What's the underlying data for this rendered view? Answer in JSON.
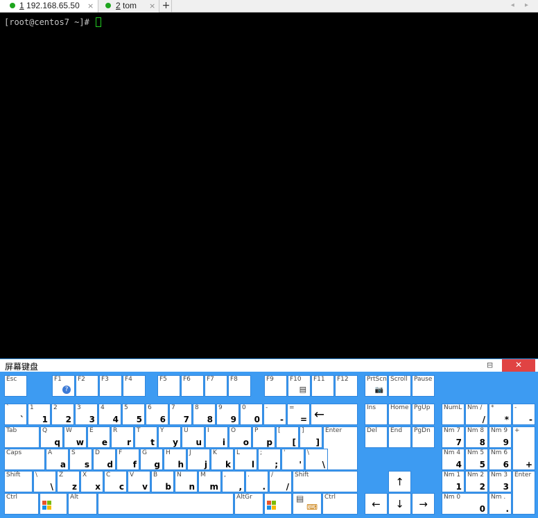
{
  "tabs": [
    {
      "num": "1",
      "label": "192.168.65.50",
      "close": "×"
    },
    {
      "num": "2",
      "label": "tom",
      "close": "×"
    }
  ],
  "new_tab": "+",
  "tab_nav": "◂ ▸",
  "terminal": {
    "prompt": "[root@centos7 ~]# "
  },
  "osk": {
    "title": "屏幕键盘",
    "pin": "⊟",
    "close": "✕"
  },
  "keys": {
    "esc": "Esc",
    "f1": "F1",
    "f2": "F2",
    "f3": "F3",
    "f4": "F4",
    "f5": "F5",
    "f6": "F6",
    "f7": "F7",
    "f8": "F8",
    "f9": "F9",
    "f10": "F10",
    "f11": "F11",
    "f12": "F12",
    "prtsc": "PrtScn",
    "scroll": "Scroll",
    "pause": "Pause",
    "n1": "1",
    "n2": "2",
    "n3": "3",
    "n4": "4",
    "n5": "5",
    "n6": "6",
    "n7": "7",
    "n8": "8",
    "n9": "9",
    "n0": "0",
    "backtick": "`",
    "minus": "-",
    "equal": "=",
    "backspace": "←",
    "ins": "Ins",
    "home": "Home",
    "pgup": "PgUp",
    "numlock": "NumL",
    "nmslash": "Nm /",
    "slash": "/",
    "star": "*",
    "dash": "-",
    "tab": "Tab",
    "q": "q",
    "w": "w",
    "e": "e",
    "r": "r",
    "t": "t",
    "y": "y",
    "u": "u",
    "i": "i",
    "o": "o",
    "p": "p",
    "Q": "Q",
    "W": "W",
    "E": "E",
    "R": "R",
    "T": "T",
    "Y": "Y",
    "U": "U",
    "I": "I",
    "O": "O",
    "P": "P",
    "lbracket": "[",
    "rbracket": "]",
    "enter": "Enter",
    "del": "Del",
    "end": "End",
    "pgdn": "PgDn",
    "nm7": "Nm 7",
    "nm8": "Nm 8",
    "nm9": "Nm 9",
    "plus": "+",
    "caps": "Caps",
    "a": "a",
    "s": "s",
    "d": "d",
    "f": "f",
    "g": "g",
    "h": "h",
    "j": "j",
    "k": "k",
    "l": "l",
    "A": "A",
    "S": "S",
    "D": "D",
    "F": "F",
    "G": "G",
    "H": "H",
    "J": "J",
    "K": "K",
    "L": "L",
    "semicolon": ";",
    "quote": "'",
    "backslash": "\\",
    "nm4": "Nm 4",
    "nm5": "Nm 5",
    "nm6": "Nm 6",
    "shift": "Shift",
    "z": "z",
    "x": "x",
    "c": "c",
    "v": "v",
    "b": "b",
    "n": "n",
    "m": "m",
    "Z": "Z",
    "X": "X",
    "C": "C",
    "V": "V",
    "B": "B",
    "N": "N",
    "M": "M",
    "comma": ",",
    "period": ".",
    "up": "↑",
    "nm1": "Nm 1",
    "nm2": "Nm 2",
    "nm3": "Nm 3",
    "ctrl": "Ctrl",
    "alt": "Alt",
    "altgr": "AltGr",
    "left": "←",
    "down": "↓",
    "right": "→",
    "nm0": "Nm 0",
    "nmdot": "Nm .",
    "dot": "."
  }
}
